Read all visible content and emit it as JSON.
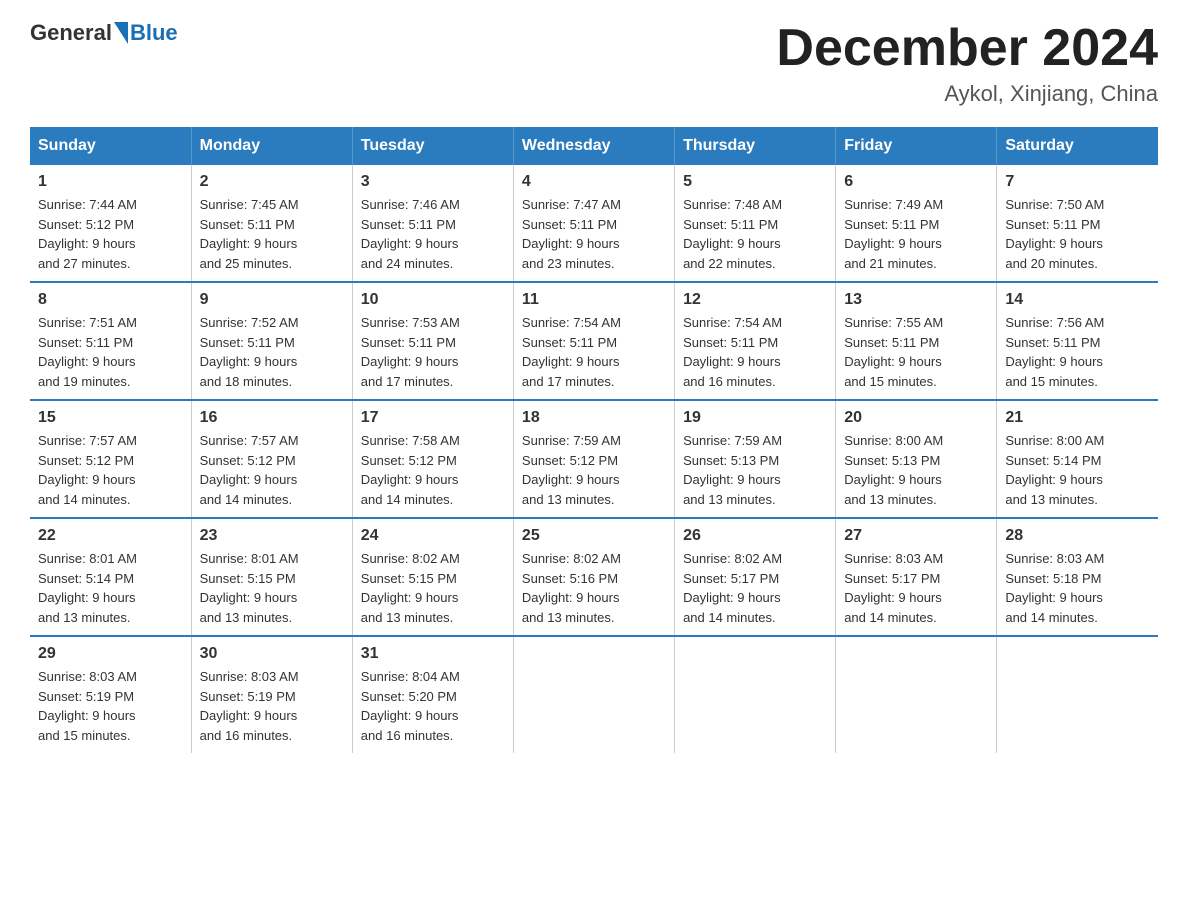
{
  "header": {
    "logo_general": "General",
    "logo_blue": "Blue",
    "month_title": "December 2024",
    "location": "Aykol, Xinjiang, China"
  },
  "weekdays": [
    "Sunday",
    "Monday",
    "Tuesday",
    "Wednesday",
    "Thursday",
    "Friday",
    "Saturday"
  ],
  "weeks": [
    [
      {
        "day": "1",
        "sunrise": "7:44 AM",
        "sunset": "5:12 PM",
        "daylight": "9 hours and 27 minutes."
      },
      {
        "day": "2",
        "sunrise": "7:45 AM",
        "sunset": "5:11 PM",
        "daylight": "9 hours and 25 minutes."
      },
      {
        "day": "3",
        "sunrise": "7:46 AM",
        "sunset": "5:11 PM",
        "daylight": "9 hours and 24 minutes."
      },
      {
        "day": "4",
        "sunrise": "7:47 AM",
        "sunset": "5:11 PM",
        "daylight": "9 hours and 23 minutes."
      },
      {
        "day": "5",
        "sunrise": "7:48 AM",
        "sunset": "5:11 PM",
        "daylight": "9 hours and 22 minutes."
      },
      {
        "day": "6",
        "sunrise": "7:49 AM",
        "sunset": "5:11 PM",
        "daylight": "9 hours and 21 minutes."
      },
      {
        "day": "7",
        "sunrise": "7:50 AM",
        "sunset": "5:11 PM",
        "daylight": "9 hours and 20 minutes."
      }
    ],
    [
      {
        "day": "8",
        "sunrise": "7:51 AM",
        "sunset": "5:11 PM",
        "daylight": "9 hours and 19 minutes."
      },
      {
        "day": "9",
        "sunrise": "7:52 AM",
        "sunset": "5:11 PM",
        "daylight": "9 hours and 18 minutes."
      },
      {
        "day": "10",
        "sunrise": "7:53 AM",
        "sunset": "5:11 PM",
        "daylight": "9 hours and 17 minutes."
      },
      {
        "day": "11",
        "sunrise": "7:54 AM",
        "sunset": "5:11 PM",
        "daylight": "9 hours and 17 minutes."
      },
      {
        "day": "12",
        "sunrise": "7:54 AM",
        "sunset": "5:11 PM",
        "daylight": "9 hours and 16 minutes."
      },
      {
        "day": "13",
        "sunrise": "7:55 AM",
        "sunset": "5:11 PM",
        "daylight": "9 hours and 15 minutes."
      },
      {
        "day": "14",
        "sunrise": "7:56 AM",
        "sunset": "5:11 PM",
        "daylight": "9 hours and 15 minutes."
      }
    ],
    [
      {
        "day": "15",
        "sunrise": "7:57 AM",
        "sunset": "5:12 PM",
        "daylight": "9 hours and 14 minutes."
      },
      {
        "day": "16",
        "sunrise": "7:57 AM",
        "sunset": "5:12 PM",
        "daylight": "9 hours and 14 minutes."
      },
      {
        "day": "17",
        "sunrise": "7:58 AM",
        "sunset": "5:12 PM",
        "daylight": "9 hours and 14 minutes."
      },
      {
        "day": "18",
        "sunrise": "7:59 AM",
        "sunset": "5:12 PM",
        "daylight": "9 hours and 13 minutes."
      },
      {
        "day": "19",
        "sunrise": "7:59 AM",
        "sunset": "5:13 PM",
        "daylight": "9 hours and 13 minutes."
      },
      {
        "day": "20",
        "sunrise": "8:00 AM",
        "sunset": "5:13 PM",
        "daylight": "9 hours and 13 minutes."
      },
      {
        "day": "21",
        "sunrise": "8:00 AM",
        "sunset": "5:14 PM",
        "daylight": "9 hours and 13 minutes."
      }
    ],
    [
      {
        "day": "22",
        "sunrise": "8:01 AM",
        "sunset": "5:14 PM",
        "daylight": "9 hours and 13 minutes."
      },
      {
        "day": "23",
        "sunrise": "8:01 AM",
        "sunset": "5:15 PM",
        "daylight": "9 hours and 13 minutes."
      },
      {
        "day": "24",
        "sunrise": "8:02 AM",
        "sunset": "5:15 PM",
        "daylight": "9 hours and 13 minutes."
      },
      {
        "day": "25",
        "sunrise": "8:02 AM",
        "sunset": "5:16 PM",
        "daylight": "9 hours and 13 minutes."
      },
      {
        "day": "26",
        "sunrise": "8:02 AM",
        "sunset": "5:17 PM",
        "daylight": "9 hours and 14 minutes."
      },
      {
        "day": "27",
        "sunrise": "8:03 AM",
        "sunset": "5:17 PM",
        "daylight": "9 hours and 14 minutes."
      },
      {
        "day": "28",
        "sunrise": "8:03 AM",
        "sunset": "5:18 PM",
        "daylight": "9 hours and 14 minutes."
      }
    ],
    [
      {
        "day": "29",
        "sunrise": "8:03 AM",
        "sunset": "5:19 PM",
        "daylight": "9 hours and 15 minutes."
      },
      {
        "day": "30",
        "sunrise": "8:03 AM",
        "sunset": "5:19 PM",
        "daylight": "9 hours and 16 minutes."
      },
      {
        "day": "31",
        "sunrise": "8:04 AM",
        "sunset": "5:20 PM",
        "daylight": "9 hours and 16 minutes."
      },
      {
        "day": "",
        "sunrise": "",
        "sunset": "",
        "daylight": ""
      },
      {
        "day": "",
        "sunrise": "",
        "sunset": "",
        "daylight": ""
      },
      {
        "day": "",
        "sunrise": "",
        "sunset": "",
        "daylight": ""
      },
      {
        "day": "",
        "sunrise": "",
        "sunset": "",
        "daylight": ""
      }
    ]
  ],
  "labels": {
    "sunrise": "Sunrise: ",
    "sunset": "Sunset: ",
    "daylight": "Daylight: "
  }
}
